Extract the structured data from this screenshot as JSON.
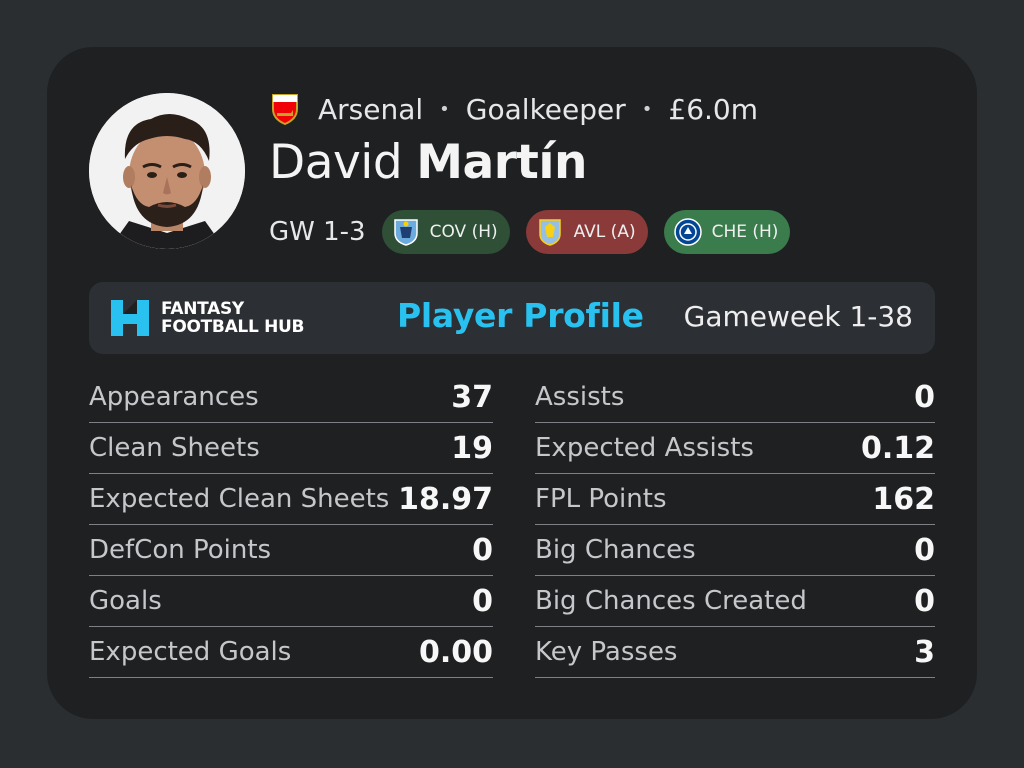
{
  "player": {
    "club": "Arsenal",
    "position": "Goalkeeper",
    "price": "£6.0m",
    "first_name": "David",
    "last_name": "Martín"
  },
  "fixtures": {
    "label": "GW 1-3",
    "items": [
      {
        "text": "COV (H)",
        "color": "#2f4f36",
        "badge": "coventry-crest-icon"
      },
      {
        "text": "AVL (A)",
        "color": "#8b3a3a",
        "badge": "aston-villa-crest-icon"
      },
      {
        "text": "CHE (H)",
        "color": "#3b7c4d",
        "badge": "chelsea-crest-icon"
      }
    ]
  },
  "banner": {
    "brand_line1": "FANTASY",
    "brand_line2": "FOOTBALL HUB",
    "title": "Player Profile",
    "range": "Gameweek 1-38"
  },
  "stats_left": [
    {
      "label": "Appearances",
      "value": "37"
    },
    {
      "label": "Clean Sheets",
      "value": "19"
    },
    {
      "label": "Expected Clean Sheets",
      "value": "18.97"
    },
    {
      "label": "DefCon Points",
      "value": "0"
    },
    {
      "label": "Goals",
      "value": "0"
    },
    {
      "label": "Expected Goals",
      "value": "0.00"
    }
  ],
  "stats_right": [
    {
      "label": "Assists",
      "value": "0"
    },
    {
      "label": "Expected Assists",
      "value": "0.12"
    },
    {
      "label": "FPL Points",
      "value": "162"
    },
    {
      "label": "Big Chances",
      "value": "0"
    },
    {
      "label": "Big Chances Created",
      "value": "0"
    },
    {
      "label": "Key Passes",
      "value": "3"
    }
  ],
  "colors": {
    "accent": "#29c2f0",
    "card_bg": "#1e2022",
    "page_bg": "#2b2e31"
  }
}
